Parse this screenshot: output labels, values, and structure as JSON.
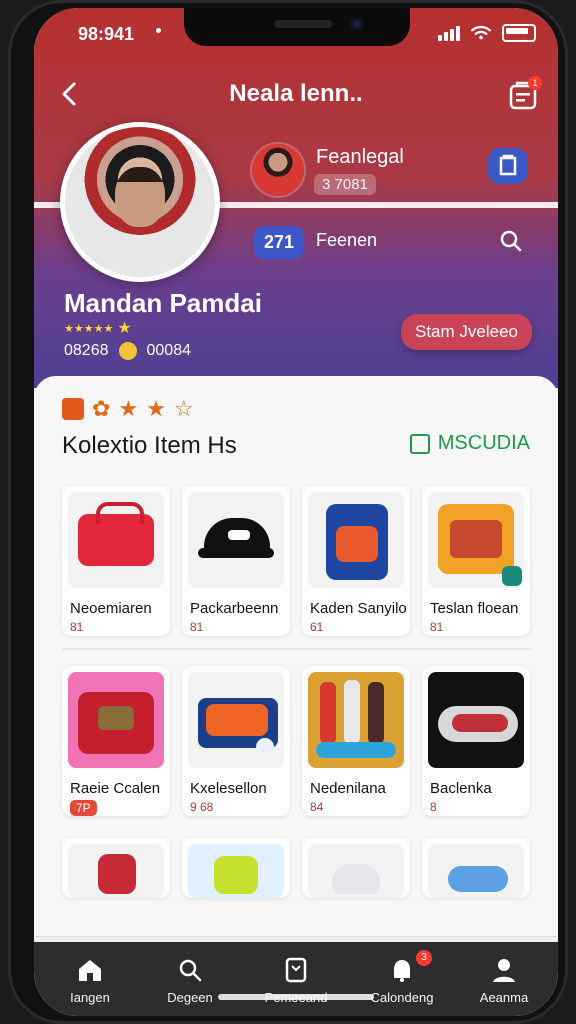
{
  "status": {
    "time": "98:941"
  },
  "topbar": {
    "title": "Neala lenn..",
    "cart_badge": "1"
  },
  "profile": {
    "mini_name": "Feanlegal",
    "mini_tag": "3 7081",
    "count": "271",
    "count_label": "Feenen",
    "name": "Mandan Pamdai",
    "stats_left": "08268",
    "stats_right": "00084",
    "action_label": "Stam Jveleeo"
  },
  "collection": {
    "section_title": "Kolextio Item Hs",
    "filter_label": "MSCUDIA"
  },
  "items_row1": [
    {
      "name": "Neoemiaren",
      "price": "81"
    },
    {
      "name": "Packarbeenn",
      "price": "81"
    },
    {
      "name": "Kaden Sanyilo",
      "price": "61"
    },
    {
      "name": "Teslan floean",
      "price": "81"
    }
  ],
  "items_row2": [
    {
      "name": "Raeie Ccalen",
      "price": "7P"
    },
    {
      "name": "Kxelesellon",
      "price": "9 68"
    },
    {
      "name": "Nedenilana",
      "price": "84"
    },
    {
      "name": "Baclenka",
      "price": "8"
    }
  ],
  "tabs": [
    {
      "label": "Iangen"
    },
    {
      "label": "Degeen"
    },
    {
      "label": "Pemeeand"
    },
    {
      "label": "Calondeng",
      "badge": "3"
    },
    {
      "label": "Aeanma"
    }
  ],
  "colors": {
    "accent_red": "#c84456",
    "accent_blue": "#3d57c8",
    "filter_green": "#1f9a4a"
  }
}
